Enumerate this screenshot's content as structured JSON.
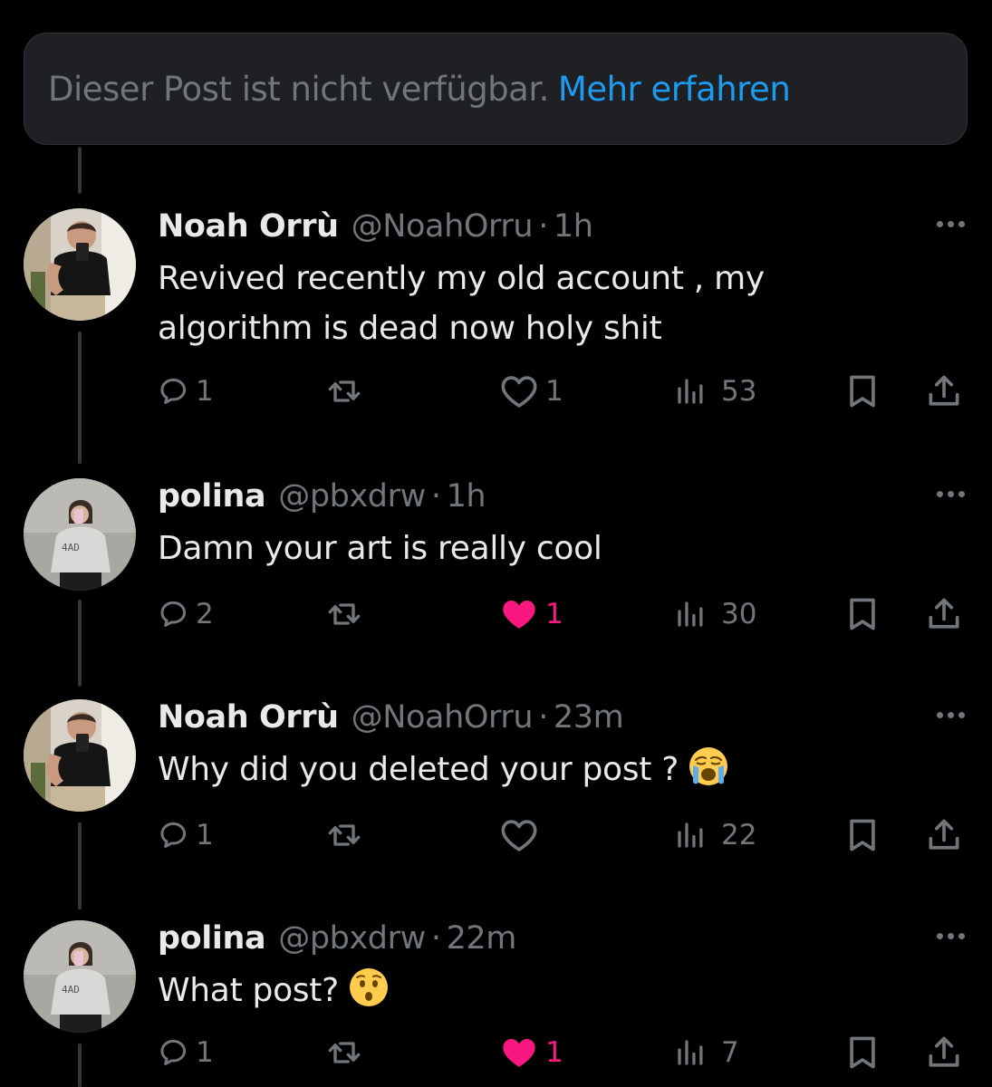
{
  "notice": {
    "text": "Dieser Post ist nicht verfügbar.",
    "link": "Mehr erfahren"
  },
  "colors": {
    "background": "#000000",
    "text": "#e7e9ea",
    "muted": "#71767b",
    "link": "#1d9bf0",
    "like": "#f91880",
    "notice_bg": "#1e2023"
  },
  "posts": [
    {
      "name": "Noah Orrù",
      "handle": "@NoahOrru",
      "dot": "·",
      "time": "1h",
      "line1": "Revived recently my old account , my",
      "line2": "algorithm is dead now holy shit",
      "replies": "1",
      "reposts": "",
      "likes": "1",
      "liked": false,
      "views": "53"
    },
    {
      "name": "polina",
      "handle": "@pbxdrw",
      "dot": "·",
      "time": "1h",
      "line1": "Damn your art is really cool",
      "replies": "2",
      "reposts": "",
      "likes": "1",
      "liked": true,
      "views": "30"
    },
    {
      "name": "Noah Orrù",
      "handle": "@NoahOrru",
      "dot": "·",
      "time": "23m",
      "line1": "Why did you deleted your post ?",
      "emoji": "loudly-crying-face-emoji",
      "replies": "1",
      "reposts": "",
      "likes": "",
      "liked": false,
      "views": "22"
    },
    {
      "name": "polina",
      "handle": "@pbxdrw",
      "dot": "·",
      "time": "22m",
      "line1": "What post?",
      "emoji": "hushed-face-emoji",
      "replies": "1",
      "reposts": "",
      "likes": "1",
      "liked": true,
      "views": "7"
    }
  ],
  "icons": {
    "reply": "reply-bubble-icon",
    "repost": "repost-arrows-icon",
    "like": "heart-icon",
    "views": "views-bar-chart-icon",
    "bookmark": "bookmark-icon",
    "share": "share-icon",
    "more": "more-dots-icon"
  }
}
